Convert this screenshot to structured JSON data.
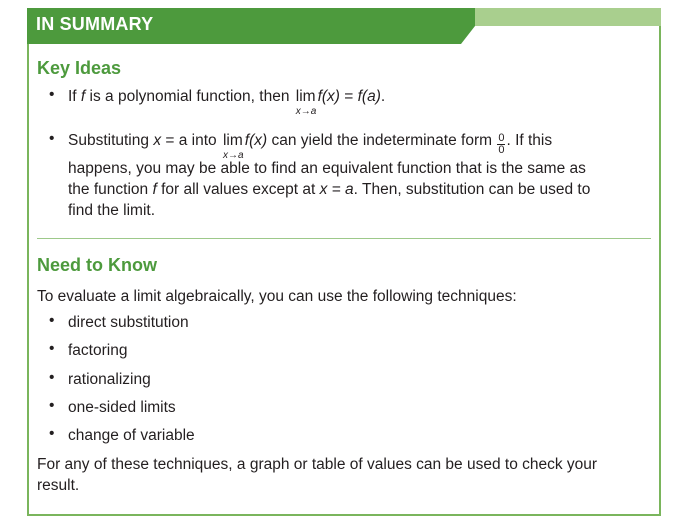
{
  "header": {
    "title": "IN SUMMARY"
  },
  "key_ideas": {
    "title": "Key Ideas",
    "bullet1": {
      "pre": "If ",
      "f": "f",
      "mid": " is a polynomial function, then ",
      "lim": "lim",
      "lim_sub": "x→a",
      "fx": "f(x)",
      "eq": " = ",
      "fa": "f(a)",
      "end": "."
    },
    "bullet2": {
      "l1_pre": "Substituting ",
      "x": "x",
      "eq_a": " = a",
      "l1_mid": " into ",
      "lim": "lim",
      "lim_sub": "x→a",
      "fx": "f(x)",
      "l1_post": " can yield the indeterminate form ",
      "frac_num": "0",
      "frac_den": "0",
      "l1_end": ". If this",
      "l2": "happens, you may be able to find an equivalent function that is the same as",
      "l3_pre": "the function ",
      "f": "f",
      "l3_mid": " for all values except at ",
      "xa": "x = a",
      "l3_end": ". Then, substitution can be used to",
      "l4": "find the limit."
    }
  },
  "need_to_know": {
    "title": "Need to Know",
    "intro": "To evaluate a limit algebraically, you can use the following techniques:",
    "items": [
      "direct substitution",
      "factoring",
      "rationalizing",
      "one-sided limits",
      "change of variable"
    ],
    "closing1": "For any of these techniques, a graph or table of values can be used to check your",
    "closing2": "result."
  },
  "colors": {
    "header_green": "#4d9a3d",
    "header_light": "#a9cf8e",
    "border": "#7ab55c"
  }
}
